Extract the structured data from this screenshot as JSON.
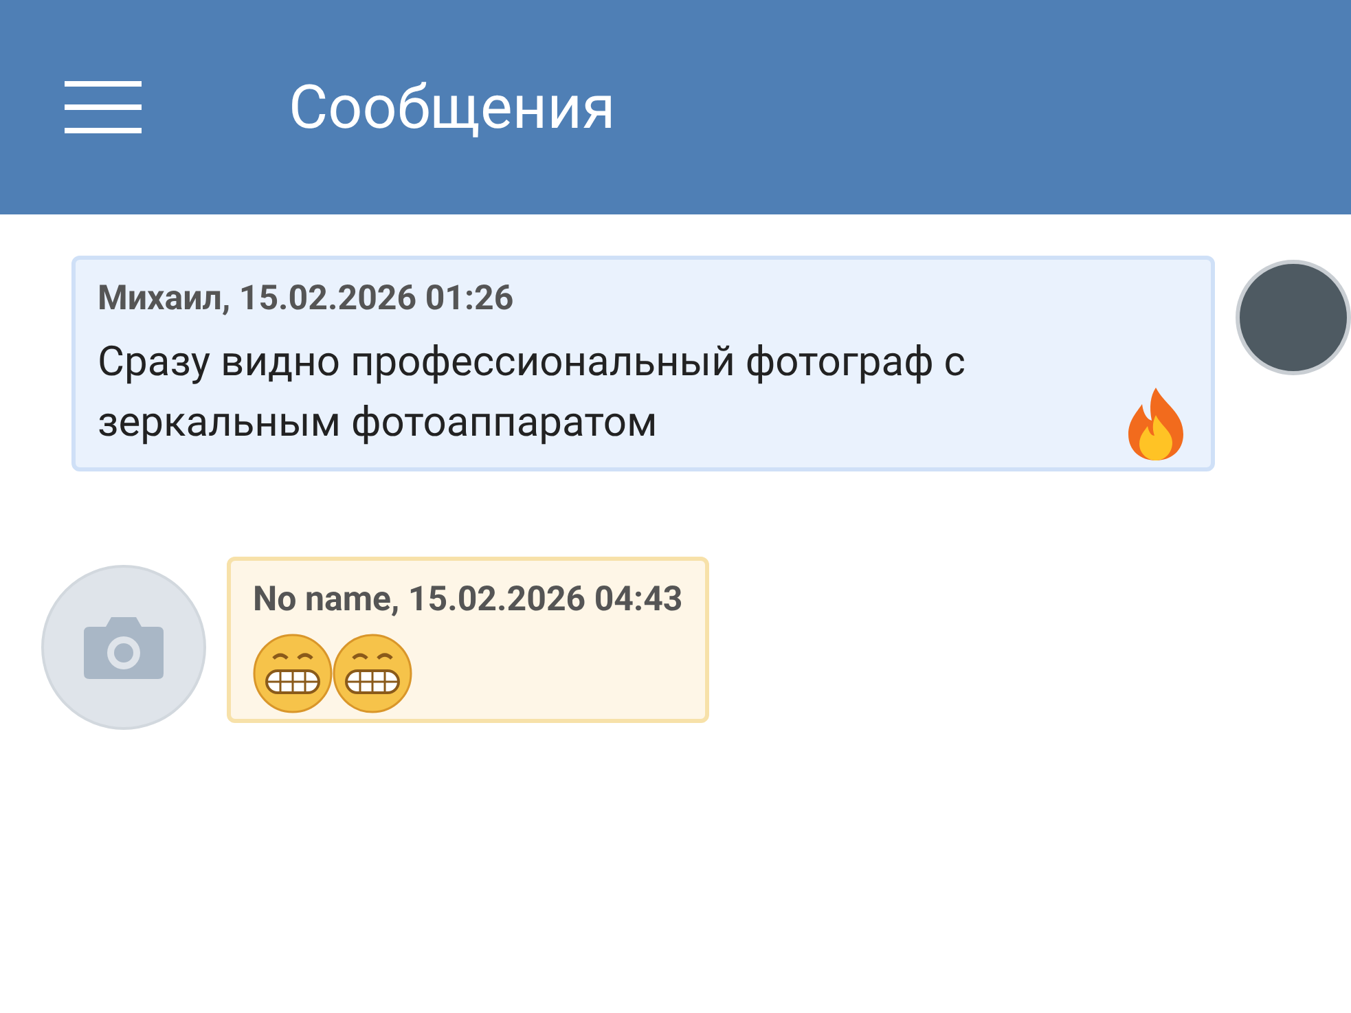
{
  "header": {
    "title": "Сообщения"
  },
  "messages": [
    {
      "author": "Михаил, 15.02.2026 01:26",
      "text": "Сразу видно профессиональный фотограф с зеркальным фотоаппаратом",
      "kind": "outgoing",
      "avatar": {
        "kind": "photo"
      },
      "emoji": [
        {
          "kind": "fire"
        }
      ]
    },
    {
      "author": "No name, 15.02.2026 04:43",
      "kind": "incoming",
      "avatar": {
        "kind": "empty"
      },
      "emoji": [
        {
          "kind": "grin"
        },
        {
          "kind": "grin"
        }
      ]
    }
  ]
}
